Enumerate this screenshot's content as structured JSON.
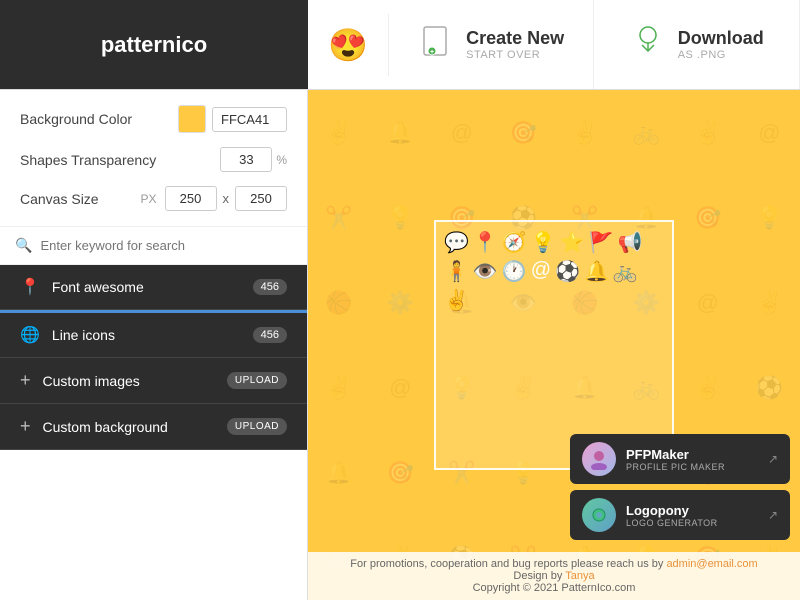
{
  "app": {
    "name": "patternico"
  },
  "header": {
    "emoji": "😍",
    "create_new": {
      "title": "Create New",
      "subtitle": "START OVER"
    },
    "download": {
      "title": "Download",
      "subtitle": "AS .PNG"
    }
  },
  "sidebar": {
    "background_color_label": "Background Color",
    "background_color_value": "FFCA41",
    "shapes_transparency_label": "Shapes Transparency",
    "shapes_transparency_value": "33",
    "shapes_transparency_unit": "%",
    "canvas_size_label": "Canvas Size",
    "canvas_px": "PX",
    "canvas_width": "250",
    "canvas_x": "x",
    "canvas_height": "250",
    "search_placeholder": "Enter keyword for search",
    "categories": [
      {
        "icon": "📍",
        "label": "Font awesome",
        "count": "456"
      },
      {
        "icon": "🌐",
        "label": "Line icons",
        "count": "456"
      }
    ],
    "custom_items": [
      {
        "label": "Custom images",
        "badge": "UPLOAD"
      },
      {
        "label": "Custom background",
        "badge": "UPLOAD"
      }
    ]
  },
  "canvas": {
    "background_color": "#FFCA41"
  },
  "floating_panels": [
    {
      "id": "pfpmaker",
      "title": "PFPMaker",
      "subtitle": "PROFILE PIC MAKER",
      "avatar_type": "pfp"
    },
    {
      "id": "logopony",
      "title": "Logopony",
      "subtitle": "LOGO GENERATOR",
      "avatar_type": "logo"
    }
  ],
  "footer": {
    "text": "For promotions, cooperation and bug reports please reach us by ",
    "email": "admin@email.com",
    "design_by": "Design by ",
    "author": "Tanya",
    "copyright": "Copyright © 2021 PatternIco.com"
  }
}
